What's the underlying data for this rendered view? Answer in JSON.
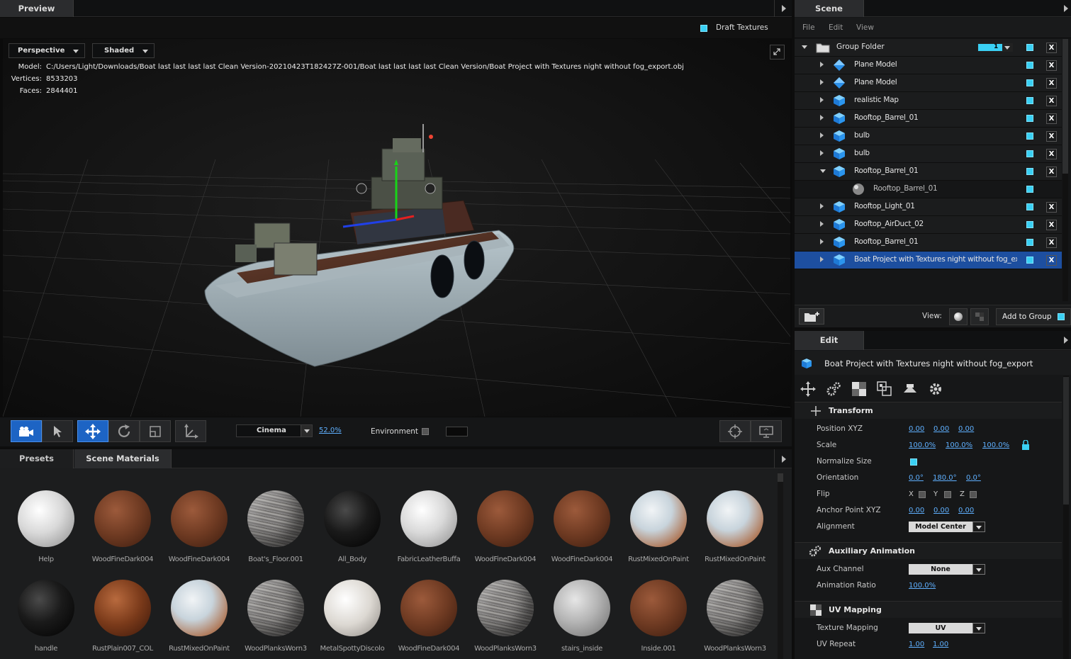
{
  "preview": {
    "tab": "Preview",
    "draft_textures_label": "Draft Textures",
    "camera_mode": "Perspective",
    "shading_mode": "Shaded",
    "model_label": "Model:",
    "model_path": "C:/Users/Light/Downloads/Boat last last last last Clean Version-20210423T182427Z-001/Boat last last last last Clean Version/Boat Project with Textures night without fog_export.obj",
    "vertices_label": "Vertices:",
    "vertices": "8533203",
    "faces_label": "Faces:",
    "faces": "2844401",
    "render_mode": "Cinema",
    "zoom": "52.0%",
    "environment_label": "Environment"
  },
  "materials": {
    "tabs": [
      "Presets",
      "Scene Materials"
    ],
    "items": [
      {
        "name": "Help",
        "type": "white"
      },
      {
        "name": "WoodFineDark004",
        "type": "wood"
      },
      {
        "name": "WoodFineDark004",
        "type": "wood"
      },
      {
        "name": "Boat's_Floor.001",
        "type": "planks"
      },
      {
        "name": "All_Body",
        "type": "black"
      },
      {
        "name": "FabricLeatherBuffa",
        "type": "white"
      },
      {
        "name": "WoodFineDark004",
        "type": "wood"
      },
      {
        "name": "WoodFineDark004",
        "type": "wood"
      },
      {
        "name": "RustMixedOnPaint",
        "type": "rustpaint"
      },
      {
        "name": "RustMixedOnPaint",
        "type": "rustpaint"
      },
      {
        "name": "handle",
        "type": "black"
      },
      {
        "name": "RustPlain007_COL",
        "type": "rust"
      },
      {
        "name": "RustMixedOnPaint",
        "type": "rustpaint"
      },
      {
        "name": "WoodPlanksWorn3",
        "type": "planks"
      },
      {
        "name": "MetalSpottyDiscolo",
        "type": "metalwhite"
      },
      {
        "name": "WoodFineDark004",
        "type": "wood"
      },
      {
        "name": "WoodPlanksWorn3",
        "type": "planks"
      },
      {
        "name": "stairs_inside",
        "type": "grey"
      },
      {
        "name": "Inside.001",
        "type": "wood"
      },
      {
        "name": "WoodPlanksWorn3",
        "type": "planks"
      }
    ]
  },
  "scene": {
    "tab": "Scene",
    "menu": [
      "File",
      "Edit",
      "View"
    ],
    "group_folder": "Group Folder",
    "group_count": "1",
    "items": [
      {
        "label": "Plane Model",
        "icon": "plane",
        "expanded": false,
        "indent": 0,
        "close": true
      },
      {
        "label": "Plane Model",
        "icon": "plane",
        "expanded": false,
        "indent": 0,
        "close": true
      },
      {
        "label": "realistic Map",
        "icon": "cube",
        "expanded": false,
        "indent": 0,
        "close": true
      },
      {
        "label": "Rooftop_Barrel_01",
        "icon": "cube",
        "expanded": false,
        "indent": 0,
        "close": true
      },
      {
        "label": "bulb",
        "icon": "cube",
        "expanded": false,
        "indent": 0,
        "close": true
      },
      {
        "label": "bulb",
        "icon": "cube",
        "expanded": false,
        "indent": 0,
        "close": true
      },
      {
        "label": "Rooftop_Barrel_01",
        "icon": "cube",
        "expanded": true,
        "indent": 0,
        "close": true
      },
      {
        "label": "Rooftop_Barrel_01",
        "icon": "material",
        "expanded": null,
        "indent": 1,
        "close": false
      },
      {
        "label": "Rooftop_Light_01",
        "icon": "cube",
        "expanded": false,
        "indent": 0,
        "close": true
      },
      {
        "label": "Rooftop_AirDuct_02",
        "icon": "cube",
        "expanded": false,
        "indent": 0,
        "close": true
      },
      {
        "label": "Rooftop_Barrel_01",
        "icon": "cube",
        "expanded": false,
        "indent": 0,
        "close": true
      },
      {
        "label": "Boat Project with Textures night without fog_ex",
        "icon": "cube",
        "expanded": false,
        "indent": 0,
        "close": true,
        "selected": true
      }
    ],
    "view_label": "View:",
    "add_to_group": "Add to Group"
  },
  "edit": {
    "tab": "Edit",
    "object_name": "Boat Project with Textures night without fog_export",
    "transform": {
      "title": "Transform",
      "position_label": "Position XYZ",
      "position": [
        "0.00",
        "0.00",
        "0.00"
      ],
      "scale_label": "Scale",
      "scale": [
        "100.0%",
        "100.0%",
        "100.0%"
      ],
      "normalize_label": "Normalize Size",
      "orientation_label": "Orientation",
      "orientation": [
        "0.0°",
        "180.0°",
        "0.0°"
      ],
      "flip_label": "Flip",
      "flip_axes": [
        "X",
        "Y",
        "Z"
      ],
      "anchor_label": "Anchor Point XYZ",
      "anchor": [
        "0.00",
        "0.00",
        "0.00"
      ],
      "alignment_label": "Alignment",
      "alignment": "Model Center"
    },
    "aux": {
      "title": "Auxiliary Animation",
      "channel_label": "Aux Channel",
      "channel": "None",
      "ratio_label": "Animation Ratio",
      "ratio": "100.0%"
    },
    "uv": {
      "title": "UV Mapping",
      "mapping_label": "Texture Mapping",
      "mapping": "UV",
      "repeat_label": "UV Repeat",
      "repeat": [
        "1.00",
        "1.00"
      ]
    }
  },
  "colors": {
    "accent": "#3ad0f4",
    "selection": "#1d4fa0",
    "link": "#5fb0ff"
  }
}
